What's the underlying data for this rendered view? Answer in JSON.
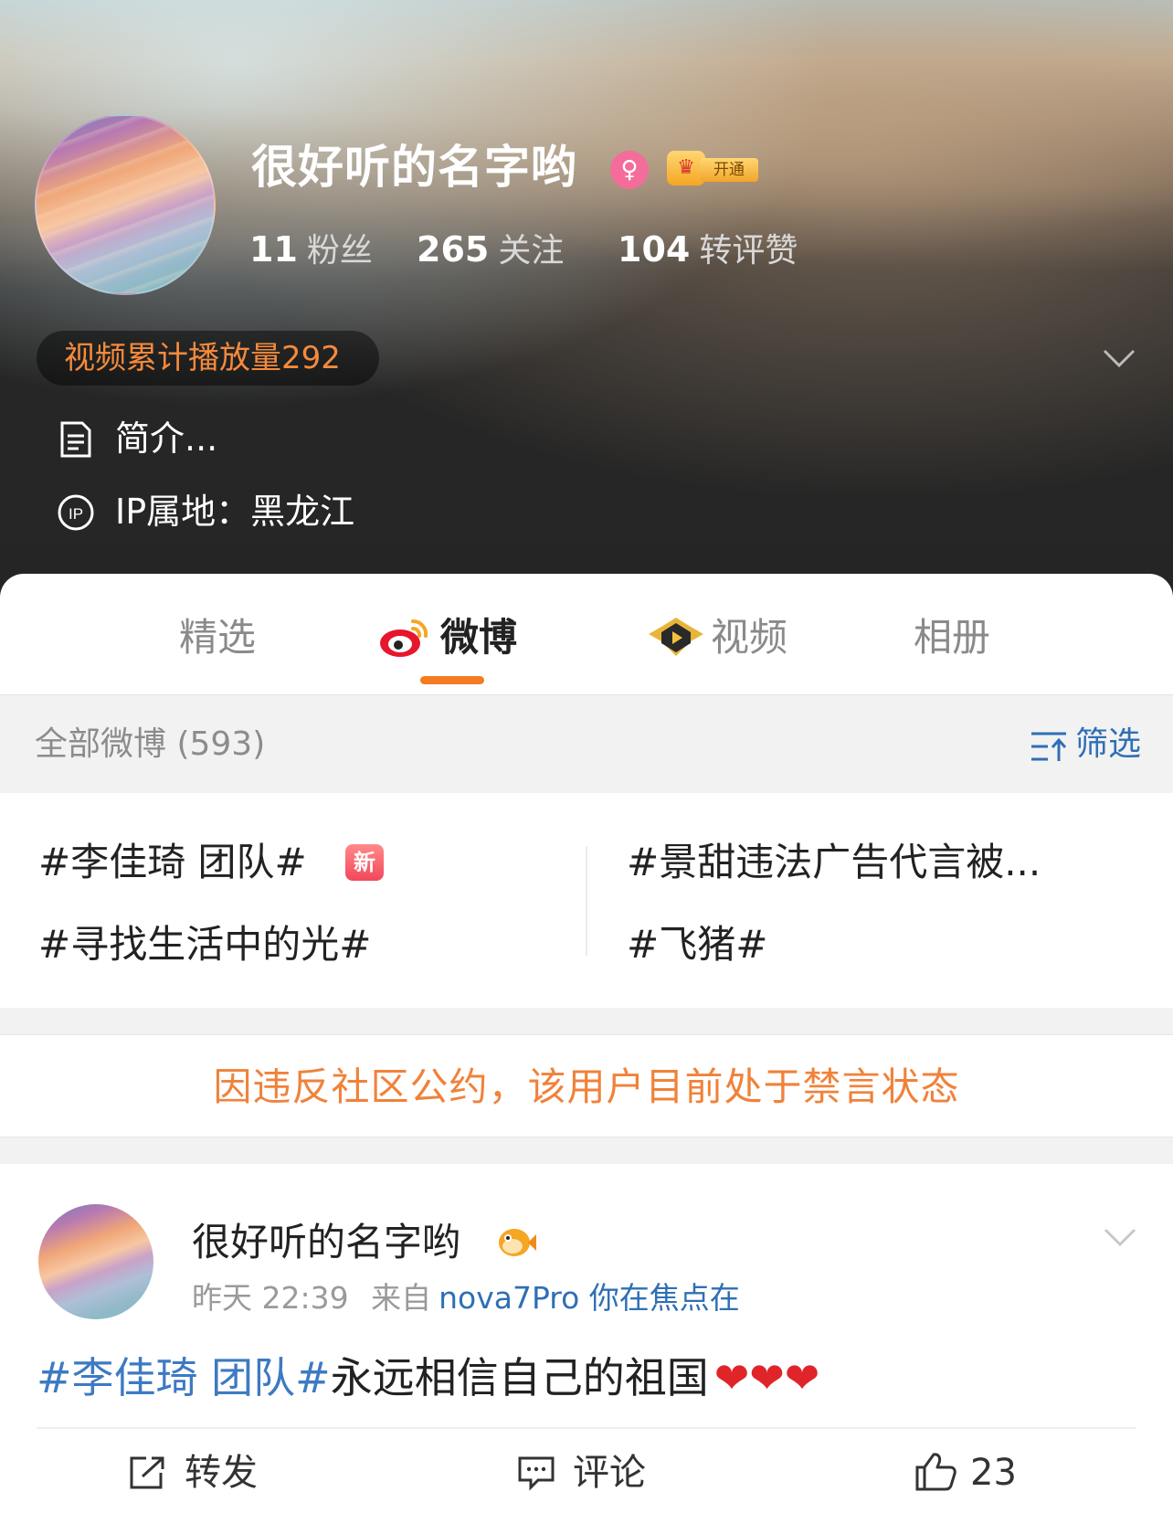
{
  "profile": {
    "username": "很好听的名字哟",
    "vip_label": "开通",
    "stats": [
      {
        "num": "11",
        "label": "粉丝"
      },
      {
        "num": "265",
        "label": "关注"
      },
      {
        "num": "104",
        "label": "转评赞"
      }
    ],
    "video_plays": "视频累计播放量292",
    "bio": "简介...",
    "ip_location": "IP属地：黑龙江"
  },
  "tabs": [
    {
      "label": "精选",
      "active": false
    },
    {
      "label": "微博",
      "active": true
    },
    {
      "label": "视频",
      "active": false
    },
    {
      "label": "相册",
      "active": false
    }
  ],
  "filter": {
    "title": "全部微博 (593)",
    "button_label": "筛选"
  },
  "topics": {
    "left": [
      "#李佳琦 团队#",
      "#寻找生活中的光#"
    ],
    "right": [
      "#景甜违法广告代言被...",
      "#飞猪#"
    ],
    "new_badge": "新"
  },
  "notice": "因违反社区公约，该用户目前处于禁言状态",
  "post": {
    "author": "很好听的名字哟",
    "time": "昨天 22:39",
    "source_prefix": "来自",
    "source": "nova7Pro 你在焦点在",
    "tag": "#李佳琦 团队#",
    "text": "永远相信自己的祖国",
    "hearts": "❤❤❤",
    "actions": {
      "repost": "转发",
      "comment": "评论",
      "like_count": "23"
    }
  },
  "colors": {
    "accent_orange": "#f47b20",
    "link_blue": "#2f6fb5",
    "notice_orange": "#f0823a"
  }
}
